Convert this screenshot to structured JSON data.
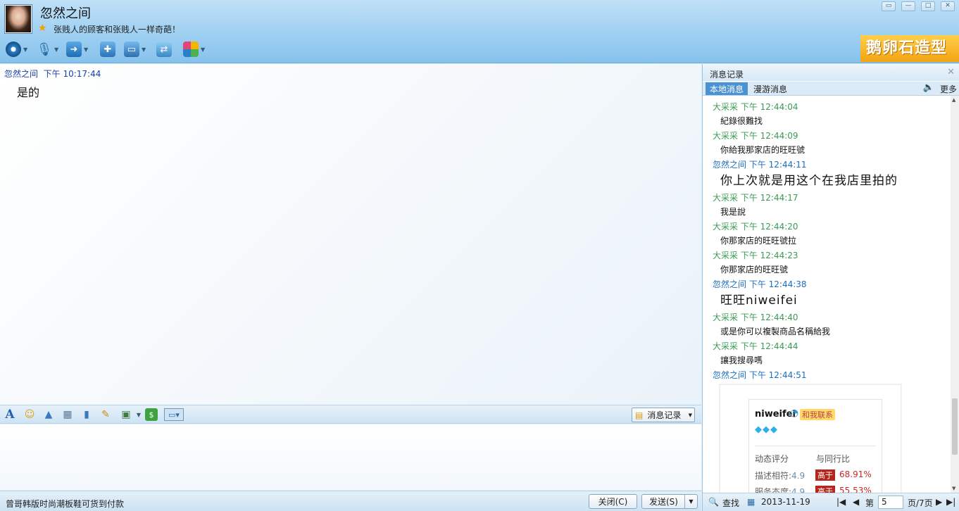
{
  "header": {
    "nickname": "忽然之间",
    "signature": "张贱人的顾客和张贱人一样奇葩！",
    "banner_text": "鹅卵石造型",
    "toolbar_icons": [
      "video-icon",
      "microphone-icon",
      "file-transfer-icon",
      "add-contact-icon",
      "screen-share-icon",
      "remote-assist-icon",
      "apps-icon"
    ]
  },
  "chat": {
    "sender": "忽然之间",
    "time": "下午 10:17:44",
    "message": "是的"
  },
  "input_toolbar": {
    "history_label": "消息记录"
  },
  "bottom": {
    "ad_text": "曾哥韩版时尚潮板鞋可货到付款",
    "close_label": "关闭(C)",
    "send_label": "发送(S)"
  },
  "history": {
    "title": "消息记录",
    "tab_local": "本地消息",
    "tab_roam": "漫游消息",
    "more_label": "更多",
    "entries": [
      {
        "head": "大采采 下午 12:44:04",
        "body": "紀錄很難找",
        "color": "green",
        "big": false
      },
      {
        "head": "大采采 下午 12:44:09",
        "body": "你給我那家店的旺旺號",
        "color": "green",
        "big": false
      },
      {
        "head": "忽然之间 下午 12:44:11",
        "body": "你上次就是用这个在我店里拍的",
        "color": "blue",
        "big": true
      },
      {
        "head": "大采采 下午 12:44:17",
        "body": "我是說",
        "color": "green",
        "big": false
      },
      {
        "head": "大采采 下午 12:44:20",
        "body": "你那家店的旺旺號拉",
        "color": "green",
        "big": false
      },
      {
        "head": "大采采 下午 12:44:23",
        "body": "你那家店的旺旺號",
        "color": "green",
        "big": false
      },
      {
        "head": "忽然之间 下午 12:44:38",
        "body": "旺旺niweifei",
        "color": "blue",
        "big": true
      },
      {
        "head": "大采采 下午 12:44:40",
        "body": "或是你可以複製商品名稱給我",
        "color": "green",
        "big": false
      },
      {
        "head": "大采采 下午 12:44:44",
        "body": "讓我搜尋嗎",
        "color": "green",
        "big": false
      },
      {
        "head": "忽然之间 下午 12:44:51",
        "body": "",
        "color": "blue",
        "big": false
      }
    ],
    "card": {
      "shop": "niweifei",
      "contact": "和我联系",
      "col1": "动态评分",
      "col2": "与同行比",
      "row1_label": "描述相符:",
      "row1_value": "4.9",
      "row1_tag": "高于",
      "row1_pct": "68.91%",
      "row2_label": "服务态度:",
      "row2_value": "4.9",
      "row2_tag": "高于",
      "row2_pct": "55.53%"
    },
    "footer": {
      "search_label": "查找",
      "date": "2013-11-19",
      "page_prefix": "第",
      "page_value": "5",
      "page_suffix": "页/7页"
    }
  }
}
